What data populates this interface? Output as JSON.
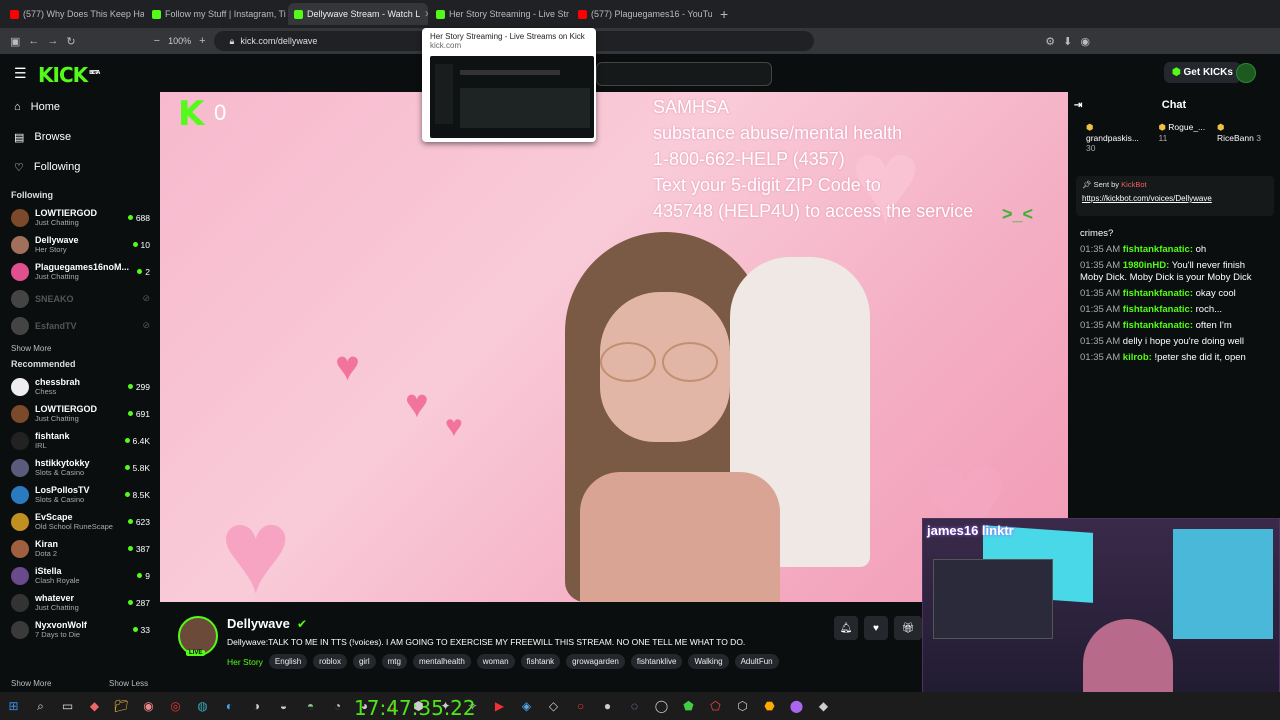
{
  "browser": {
    "tabs": [
      {
        "label": "(577) Why Does This Keep Happ",
        "color": "#ff0000"
      },
      {
        "label": "Follow my Stuff | Instagram, Tik",
        "color": "#53fc18"
      },
      {
        "label": "Dellywave Stream - Watch L",
        "color": "#53fc18",
        "active": true
      },
      {
        "label": "Her Story Streaming - Live Str",
        "color": "#53fc18"
      },
      {
        "label": "(577) Plaguegames16 - YouTub",
        "color": "#ff0000"
      }
    ],
    "new_tab": "+",
    "zoom": "100%",
    "url": "kick.com/dellywave",
    "tab_preview": {
      "title": "Her Story Streaming - Live Streams on Kick",
      "domain": "kick.com"
    }
  },
  "header": {
    "logo": "KICK",
    "beta": "BETA",
    "get_kicks": "Get KICKs"
  },
  "sidebar": {
    "nav": [
      {
        "label": "Home",
        "icon": "home-icon"
      },
      {
        "label": "Browse",
        "icon": "browse-icon"
      },
      {
        "label": "Following",
        "icon": "heart-icon"
      }
    ],
    "following_title": "Following",
    "following": [
      {
        "name": "LOWTIERGOD",
        "cat": "Just Chatting",
        "viewers": "688",
        "color": "#7a4a2a"
      },
      {
        "name": "Dellywave",
        "cat": "Her Story",
        "viewers": "10",
        "color": "#a0705a"
      },
      {
        "name": "Plaguegames16noM...",
        "cat": "Just Chatting",
        "viewers": "2",
        "color": "#e05090"
      },
      {
        "name": "SNEAKO",
        "cat": "",
        "viewers": "",
        "color": "#444",
        "offline": true
      },
      {
        "name": "EsfandTV",
        "cat": "",
        "viewers": "",
        "color": "#444",
        "offline": true
      }
    ],
    "show_more_1": "Show More",
    "recommended_title": "Recommended",
    "recommended": [
      {
        "name": "chessbrah",
        "cat": "Chess",
        "viewers": "299",
        "color": "#eee"
      },
      {
        "name": "LOWTIERGOD",
        "cat": "Just Chatting",
        "viewers": "691",
        "color": "#7a4a2a"
      },
      {
        "name": "fishtank",
        "cat": "IRL",
        "viewers": "6.4K",
        "color": "#222"
      },
      {
        "name": "hstikkytokky",
        "cat": "Slots & Casino",
        "viewers": "5.8K",
        "color": "#5a5a7a"
      },
      {
        "name": "LosPollosTV",
        "cat": "Slots & Casino",
        "viewers": "8.5K",
        "color": "#2a7ac0"
      },
      {
        "name": "EvScape",
        "cat": "Old School RuneScape",
        "viewers": "623",
        "color": "#c09020"
      },
      {
        "name": "Kiran",
        "cat": "Dota 2",
        "viewers": "387",
        "color": "#a06040"
      },
      {
        "name": "iStella",
        "cat": "Clash Royale",
        "viewers": "9",
        "color": "#6a4a8a"
      },
      {
        "name": "whatever",
        "cat": "Just Chatting",
        "viewers": "287",
        "color": "#333"
      },
      {
        "name": "NyxvonWolf",
        "cat": "7 Days to Die",
        "viewers": "33",
        "color": "#3a3a3a"
      }
    ],
    "show_more_2": "Show More",
    "show_less": "Show Less"
  },
  "video": {
    "k_count": "0",
    "overlay_lines": [
      "SAMHSA",
      "substance abuse/mental health",
      "1-800-662-HELP (4357)",
      "Text your 5-digit ZIP Code to",
      "435748 (HELP4U) to access the service"
    ],
    "emote": ">_<"
  },
  "stream": {
    "name": "Dellywave",
    "live": "LIVE",
    "title": "Dellywave:TALK TO ME IN TTS (!voices). I AM GOING TO EXERCISE MY FREEWILL THIS STREAM.  NO ONE TELL ME WHAT TO DO.",
    "category": "Her Story",
    "tags": [
      "English",
      "roblox",
      "girl",
      "mtg",
      "mentalhealth",
      "woman",
      "fishtank",
      "growagarden",
      "fishtanklive",
      "Walking",
      "AdultFun"
    ]
  },
  "chat": {
    "title": "Chat",
    "leaders": [
      {
        "name": "grandpaskis...",
        "count": "30"
      },
      {
        "name": "Rogue_...",
        "count": "11"
      },
      {
        "name": "RiceBann",
        "count": "3"
      }
    ],
    "pinned": {
      "sent_by": "Sent by",
      "bot": "KickBot",
      "link": "https://kickbot.com/voices/Dellywave"
    },
    "messages": [
      {
        "time": "",
        "user": "",
        "text": "crimes?"
      },
      {
        "time": "01:35 AM",
        "user": "fishtankfanatic:",
        "text": "oh"
      },
      {
        "time": "01:35 AM",
        "user": "1980inHD:",
        "text": "You'll never finish Moby Dick. Moby Dick is your Moby Dick"
      },
      {
        "time": "01:35 AM",
        "user": "fishtankfanatic:",
        "text": "okay cool"
      },
      {
        "time": "01:35 AM",
        "user": "fishtankfanatic:",
        "text": "roch..."
      },
      {
        "time": "01:35 AM",
        "user": "fishtankfanatic:",
        "text": "often I'm"
      },
      {
        "time": "01:35 AM",
        "user": "",
        "text": "delly i hope you're doing well"
      },
      {
        "time": "01:35 AM",
        "user": "kilrob:",
        "text": "!peter she did it, open"
      }
    ]
  },
  "taskbar": {
    "clock": "17:47:35.22"
  }
}
